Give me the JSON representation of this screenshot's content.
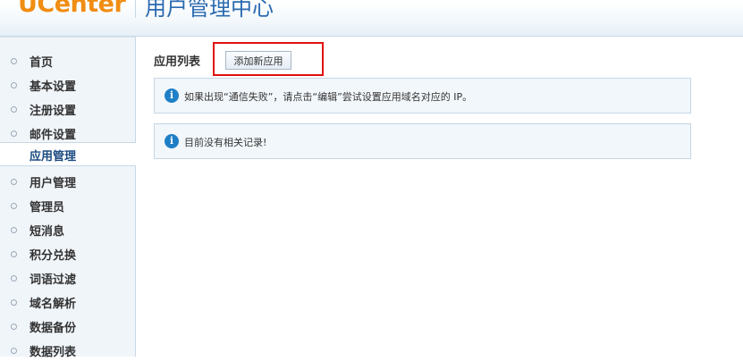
{
  "header": {
    "logo": "UCenter",
    "title": "用户管理中心"
  },
  "sidebar": {
    "items": [
      {
        "label": "首页"
      },
      {
        "label": "基本设置"
      },
      {
        "label": "注册设置"
      },
      {
        "label": "邮件设置"
      },
      {
        "label": "应用管理",
        "active": true
      },
      {
        "label": "用户管理"
      },
      {
        "label": "管理员"
      },
      {
        "label": "短消息"
      },
      {
        "label": "积分兑换"
      },
      {
        "label": "词语过滤"
      },
      {
        "label": "域名解析"
      },
      {
        "label": "数据备份"
      },
      {
        "label": "数据列表"
      }
    ]
  },
  "main": {
    "section_title": "应用列表",
    "add_button_label": "添加新应用",
    "notices": [
      {
        "text": "如果出现“通信失败”，请点击“编辑”尝试设置应用域名对应的 IP。"
      },
      {
        "text": "目前没有相关记录!"
      }
    ]
  },
  "colors": {
    "logo": "#f08d12",
    "title": "#2a6ab0",
    "highlight": "#e01010",
    "info_icon": "#1f7fc6"
  }
}
